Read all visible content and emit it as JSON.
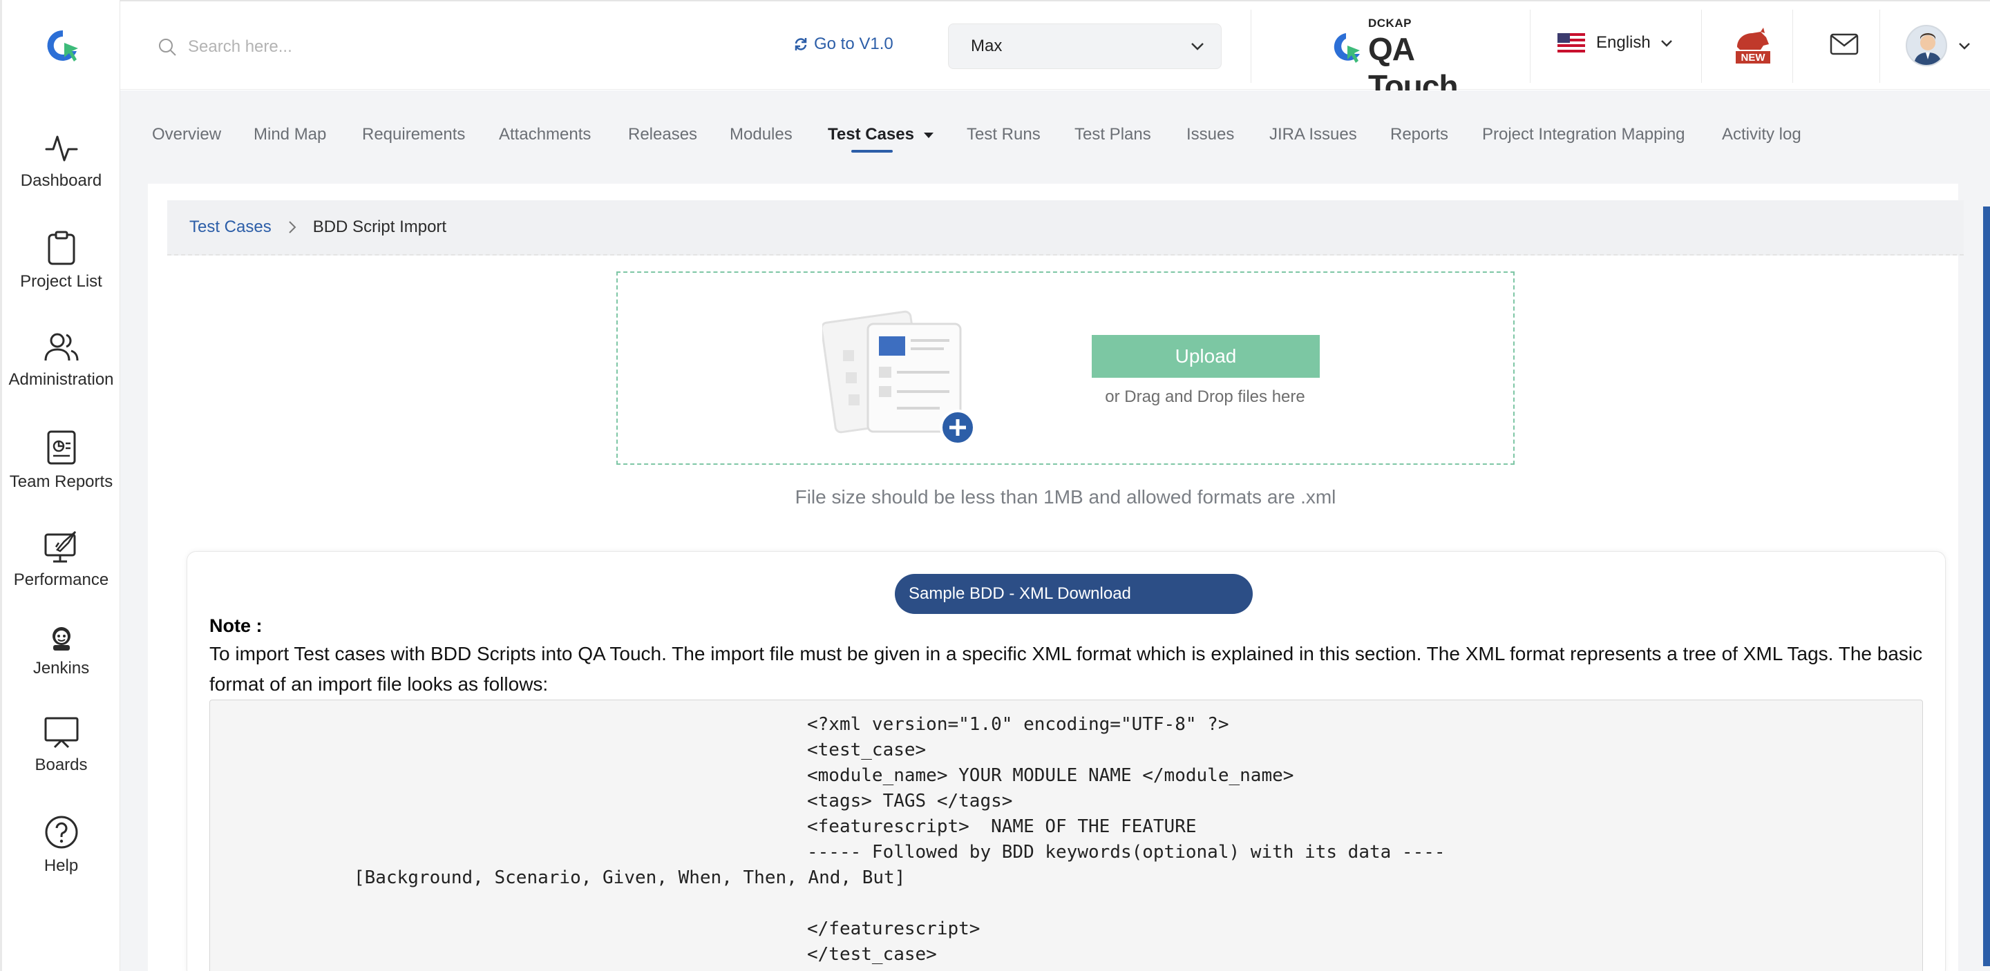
{
  "sidebar": {
    "items": [
      {
        "label": "Dashboard",
        "icon": "activity-icon"
      },
      {
        "label": "Project List",
        "icon": "clipboard-icon"
      },
      {
        "label": "Administration",
        "icon": "users-icon"
      },
      {
        "label": "Team Reports",
        "icon": "report-icon"
      },
      {
        "label": "Performance",
        "icon": "rocket-icon"
      },
      {
        "label": "Jenkins",
        "icon": "jenkins-icon"
      },
      {
        "label": "Boards",
        "icon": "board-icon"
      },
      {
        "label": "Help",
        "icon": "help-icon"
      }
    ]
  },
  "header": {
    "search_placeholder": "Search here...",
    "goto_label": "Go to V1.0",
    "project_value": "Max",
    "brand_small": "DCKAP",
    "brand_name": "QA Touch",
    "language": "English",
    "new_badge": "NEW"
  },
  "tabs": [
    {
      "label": "Overview"
    },
    {
      "label": "Mind Map"
    },
    {
      "label": "Requirements"
    },
    {
      "label": "Attachments"
    },
    {
      "label": "Releases"
    },
    {
      "label": "Modules"
    },
    {
      "label": "Test Cases",
      "active": true
    },
    {
      "label": "Test Runs"
    },
    {
      "label": "Test Plans"
    },
    {
      "label": "Issues"
    },
    {
      "label": "JIRA Issues"
    },
    {
      "label": "Reports"
    },
    {
      "label": "Project Integration Mapping"
    },
    {
      "label": "Activity log"
    }
  ],
  "breadcrumb": {
    "parent": "Test Cases",
    "current": "BDD Script Import"
  },
  "upload": {
    "button_label": "Upload",
    "drag_text": "or Drag and Drop files here",
    "file_hint": "File size should be less than 1MB and allowed formats are .xml"
  },
  "note": {
    "sample_button": "Sample BDD - XML Download",
    "title": "Note :",
    "body": "To import Test cases with BDD Scripts into QA Touch. The import file must be given in a specific XML format which is explained in this section. The XML format represents a tree of XML Tags. The basic format of an import file looks as follows:",
    "code_lines": [
      "<?xml version=\"1.0\" encoding=\"UTF-8\" ?>",
      "<test_case>",
      "<module_name> YOUR MODULE NAME </module_name>",
      "<tags> TAGS </tags>",
      "<featurescript>  NAME OF THE FEATURE",
      "----- Followed by BDD keywords(optional) with its data ----",
      "[Background, Scenario, Given, When, Then, And, But]",
      "",
      "</featurescript>",
      "</test_case>"
    ]
  },
  "colors": {
    "primary": "#2c5ea8",
    "upload_green": "#7cc7a3",
    "dark_button": "#2c4e86",
    "badge_red": "#c0392b"
  }
}
